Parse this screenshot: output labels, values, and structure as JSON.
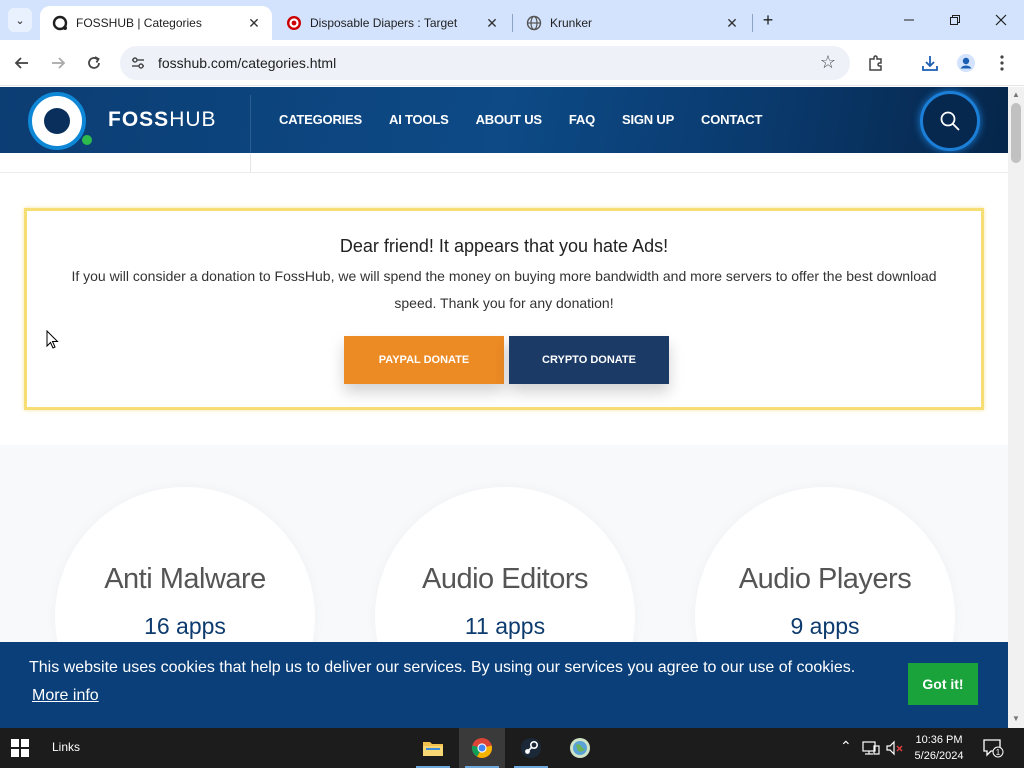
{
  "browser": {
    "tabs": [
      {
        "title": "FOSSHUB | Categories",
        "close": "✕",
        "active": true
      },
      {
        "title": "Disposable Diapers : Target",
        "close": "✕",
        "active": false
      },
      {
        "title": "Krunker",
        "close": "✕",
        "active": false
      }
    ],
    "new_tab": "+",
    "url": "fosshub.com/categories.html"
  },
  "header": {
    "logo_bold": "FOSS",
    "logo_light": "HUB",
    "nav": [
      "CATEGORIES",
      "AI TOOLS",
      "ABOUT US",
      "FAQ",
      "SIGN UP",
      "CONTACT"
    ]
  },
  "donate": {
    "title": "Dear friend! It appears that you hate Ads!",
    "text": "If you will consider a donation to FossHub, we will spend the money on buying more bandwidth and more servers to offer the best download speed. Thank you for any donation!",
    "paypal_label": "PAYPAL DONATE",
    "crypto_label": "CRYPTO DONATE"
  },
  "categories": [
    {
      "name": "Anti Malware",
      "count": "16 apps"
    },
    {
      "name": "Audio Editors",
      "count": "11 apps"
    },
    {
      "name": "Audio Players",
      "count": "9 apps"
    }
  ],
  "cookie": {
    "text": "This website uses cookies that help us to deliver our services. By using our services you agree to our use of cookies.",
    "more_info": "More info",
    "button": "Got it!"
  },
  "taskbar": {
    "links": "Links",
    "time": "10:36 PM",
    "date": "5/26/2024",
    "notifications": "1"
  },
  "colors": {
    "header_bg": "#0c3d73",
    "paypal": "#ec8a24",
    "crypto": "#1b3a66",
    "cookie_bg": "#0b3f79",
    "cookie_button": "#1aa33b",
    "donate_border": "#f7de74"
  }
}
